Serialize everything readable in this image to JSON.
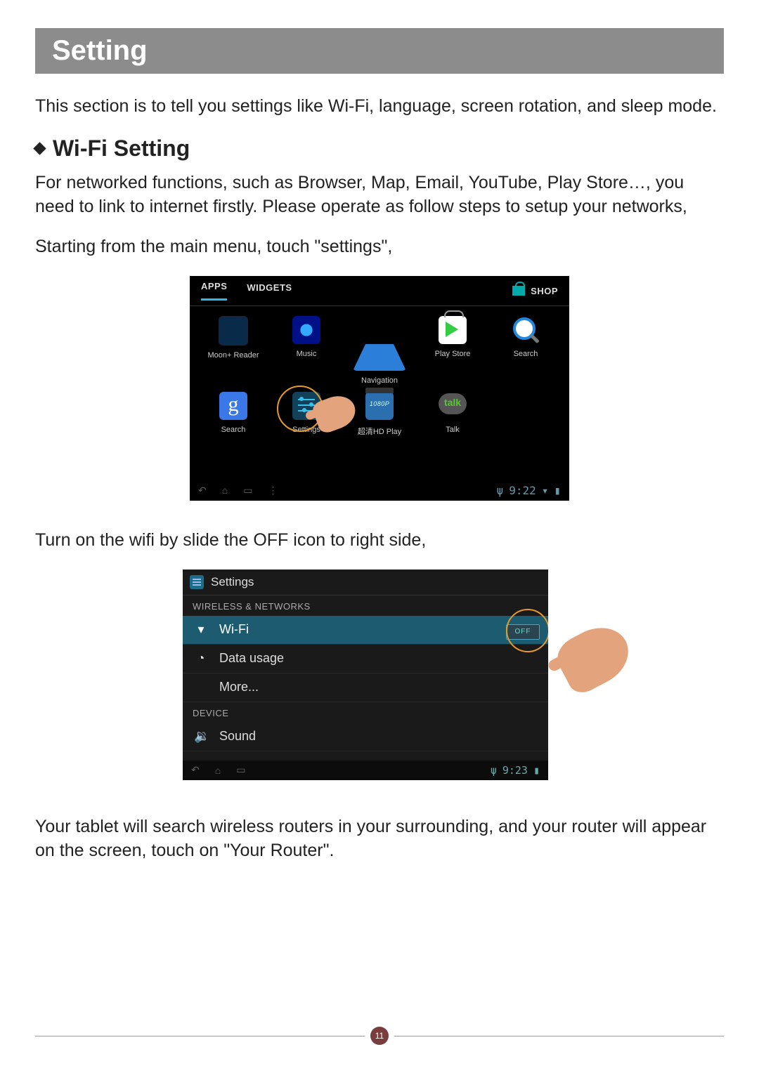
{
  "title": "Setting",
  "intro": "This section is to tell you settings like Wi-Fi, language, screen rotation, and sleep mode.",
  "sub_heading": "Wi-Fi Setting",
  "para1": "For networked functions, such as Browser, Map, Email, YouTube, Play Store…, you need to link to internet firstly. Please operate as follow steps to setup your networks,",
  "para2": "Starting from the main menu, touch \"settings\",",
  "para3": "Turn on the wifi by slide the OFF icon to right side,",
  "para4": "Your tablet will search wireless routers in your surrounding, and your router will appear on the screen, touch on \"Your Router\".",
  "page_number": "11",
  "shot1": {
    "tabs": {
      "apps": "APPS",
      "widgets": "WIDGETS",
      "shop": "SHOP"
    },
    "apps_row1": [
      {
        "label": "Moon+ Reader"
      },
      {
        "label": "Music"
      },
      {
        "label": "Navigation"
      },
      {
        "label": "Play Store"
      },
      {
        "label": "Search"
      }
    ],
    "apps_row2": [
      {
        "label": "Search"
      },
      {
        "label": "Settings"
      },
      {
        "label": "超清HD Play"
      },
      {
        "label": "Talk"
      }
    ],
    "status_time": "9:22"
  },
  "shot2": {
    "header": "Settings",
    "cat_wireless": "WIRELESS & NETWORKS",
    "row_wifi": "Wi-Fi",
    "row_data": "Data usage",
    "row_more": "More...",
    "cat_device": "DEVICE",
    "row_sound": "Sound",
    "toggle_text": "OFF",
    "status_time": "9:23"
  }
}
